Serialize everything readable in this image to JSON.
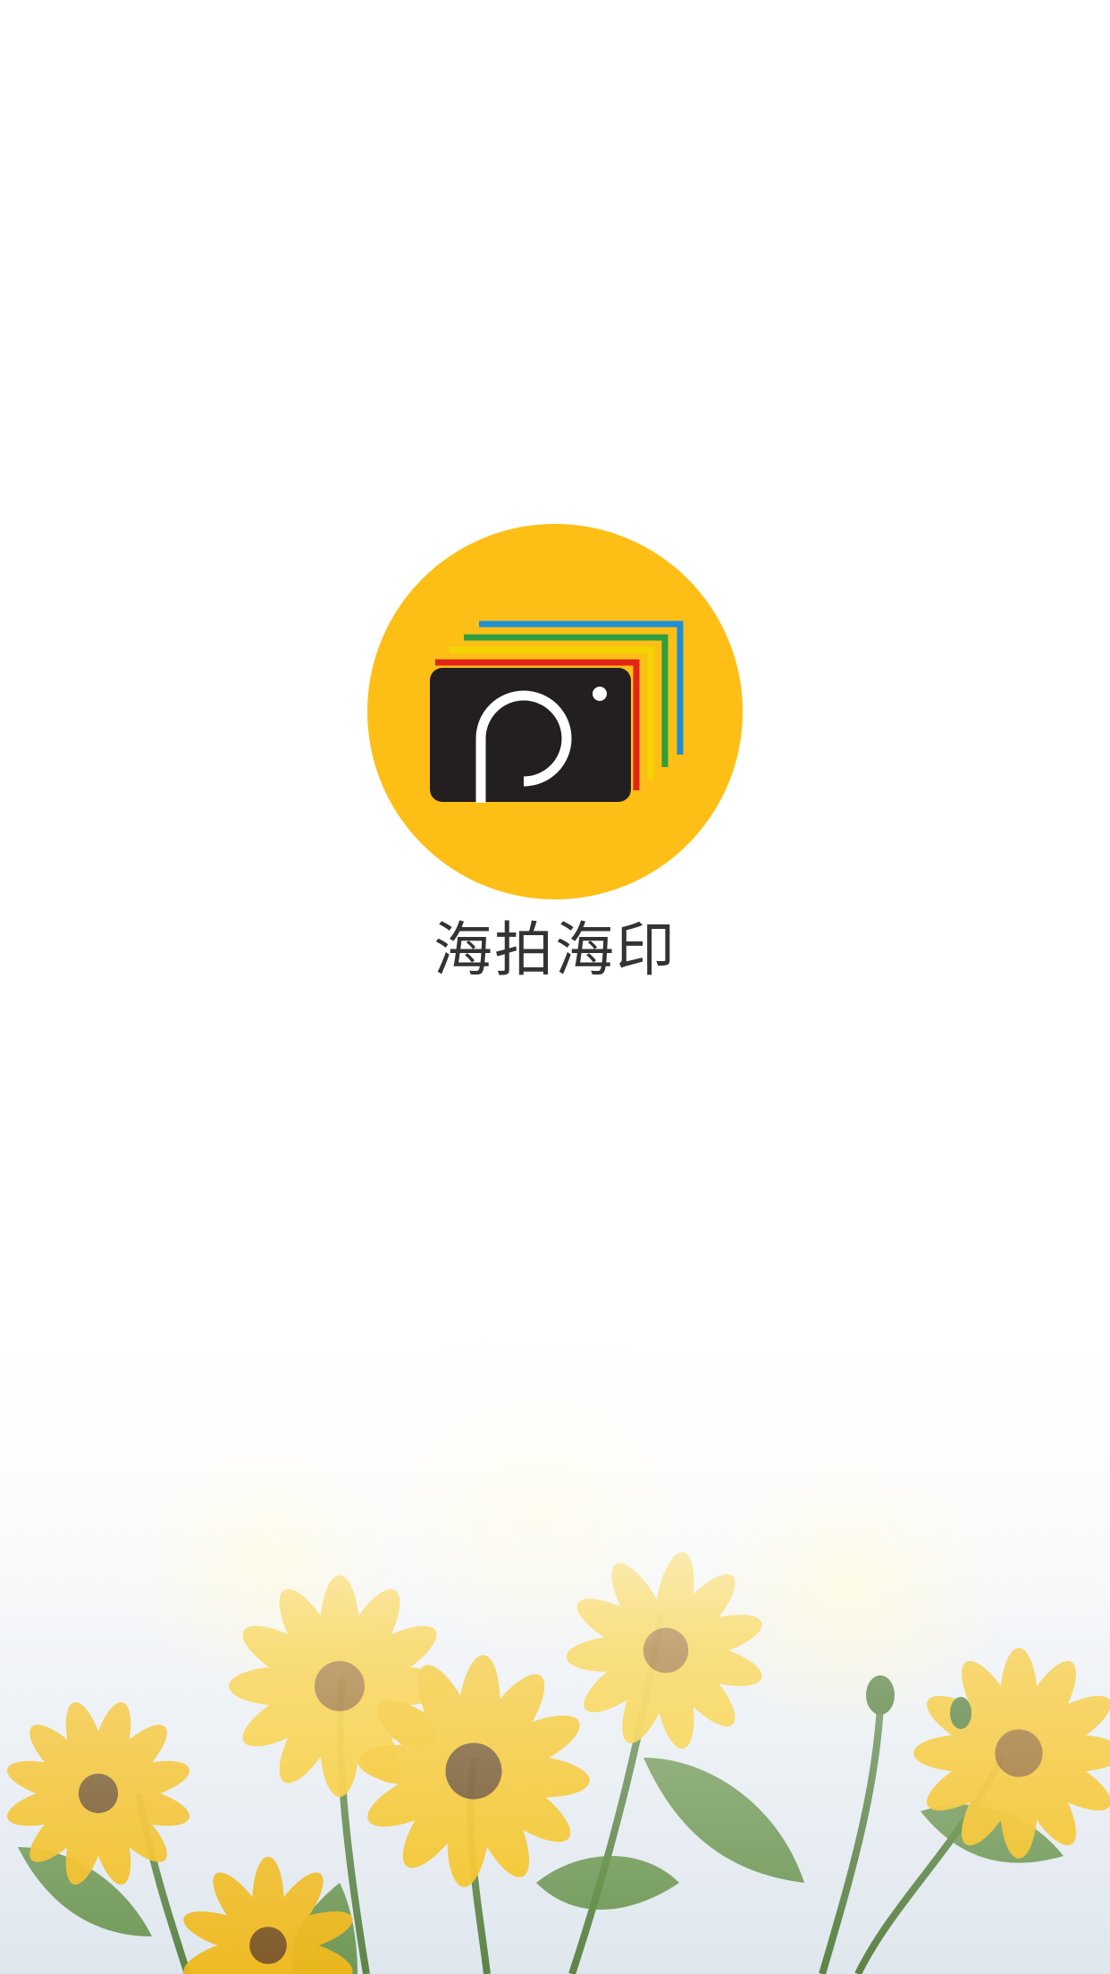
{
  "app": {
    "name": "海拍海印",
    "logo_icon": "camera-photo-stack-icon",
    "colors": {
      "brand_yellow": "#FDBF16",
      "camera_body": "#231F20",
      "stripe_blue": "#1E8FD6",
      "stripe_green": "#2F9E3E",
      "stripe_yellow": "#F4D400",
      "stripe_red": "#E3241B"
    }
  },
  "background": {
    "image": "yellow-flowers-photo"
  }
}
